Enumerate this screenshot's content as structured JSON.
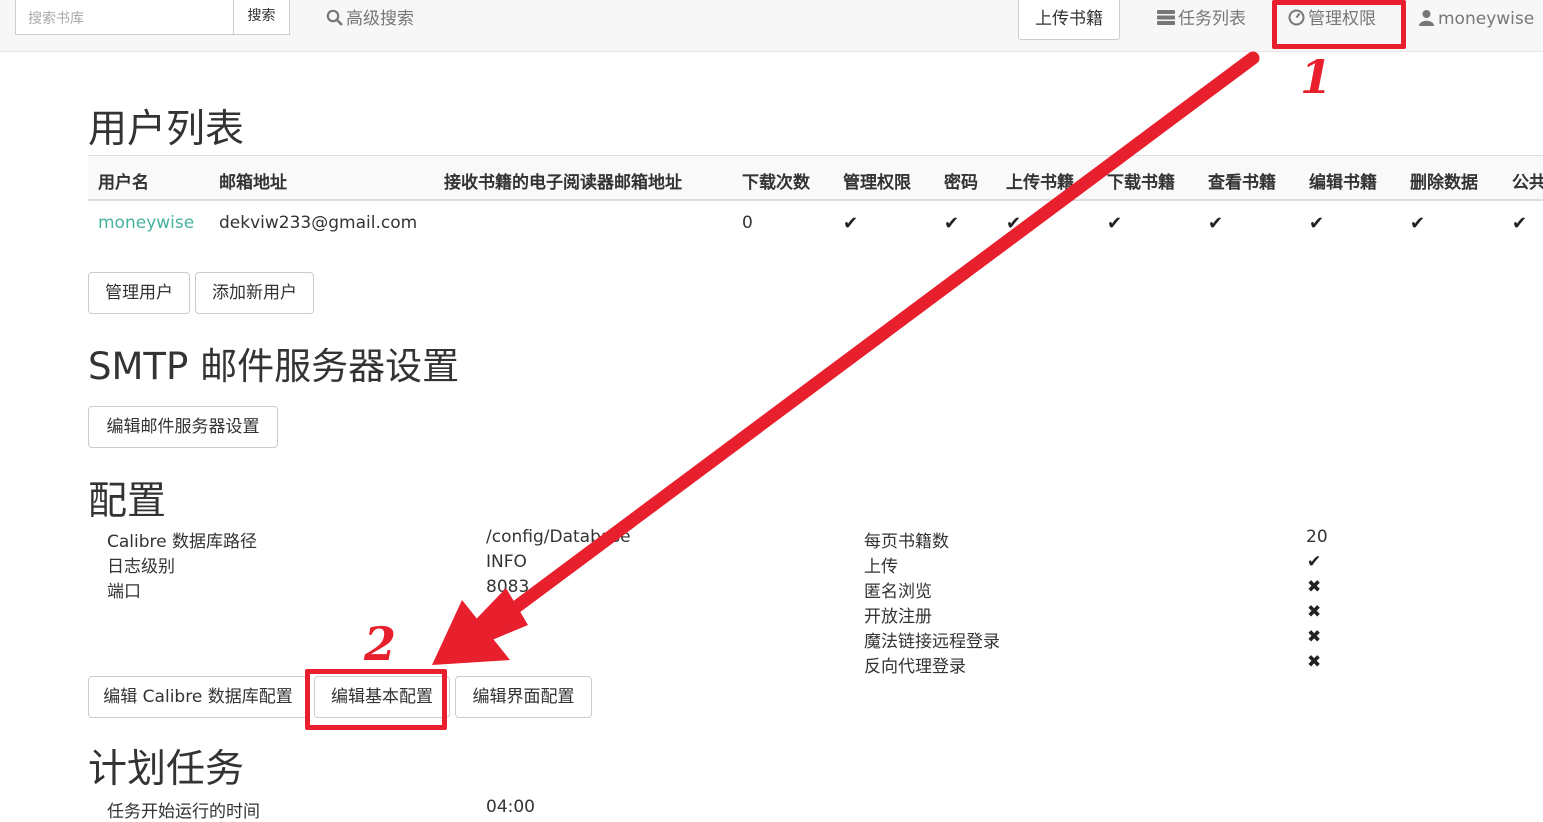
{
  "navbar": {
    "search_placeholder": "搜索书库",
    "search_button": "搜索",
    "advanced_search": "高级搜索",
    "upload_books": "上传书籍",
    "task_list": "任务列表",
    "admin": "管理权限",
    "username": "moneywise"
  },
  "users": {
    "title": "用户列表",
    "columns": [
      "用户名",
      "邮箱地址",
      "接收书籍的电子阅读器邮箱地址",
      "下载次数",
      "管理权限",
      "密码",
      "上传书籍",
      "下载书籍",
      "查看书籍",
      "编辑书籍",
      "删除数据",
      "公共"
    ],
    "rows": [
      {
        "username": "moneywise",
        "email": "dekviw233@gmail.com",
        "kindle_email": "",
        "downloads": "0",
        "check": "✔"
      }
    ],
    "manage_users_btn": "管理用户",
    "add_user_btn": "添加新用户"
  },
  "smtp": {
    "title": "SMTP 邮件服务器设置",
    "edit_btn": "编辑邮件服务器设置"
  },
  "config": {
    "title": "配置",
    "left": [
      {
        "label": "Calibre 数据库路径",
        "value": "/config/Database"
      },
      {
        "label": "日志级别",
        "value": "INFO"
      },
      {
        "label": "端口",
        "value": "8083"
      }
    ],
    "right": [
      {
        "label": "每页书籍数",
        "value": "20"
      },
      {
        "label": "上传",
        "value": "✔"
      },
      {
        "label": "匿名浏览",
        "value": "✖"
      },
      {
        "label": "开放注册",
        "value": "✖"
      },
      {
        "label": "魔法链接远程登录",
        "value": "✖"
      },
      {
        "label": "反向代理登录",
        "value": "✖"
      }
    ],
    "edit_db_btn": "编辑 Calibre 数据库配置",
    "edit_basic_btn": "编辑基本配置",
    "edit_ui_btn": "编辑界面配置"
  },
  "scheduled": {
    "title": "计划任务",
    "start_time_label": "任务开始运行的时间",
    "start_time_value": "04:00"
  },
  "annotations": {
    "step1": "1",
    "step2": "2",
    "highlight_color": "#e8202d"
  }
}
